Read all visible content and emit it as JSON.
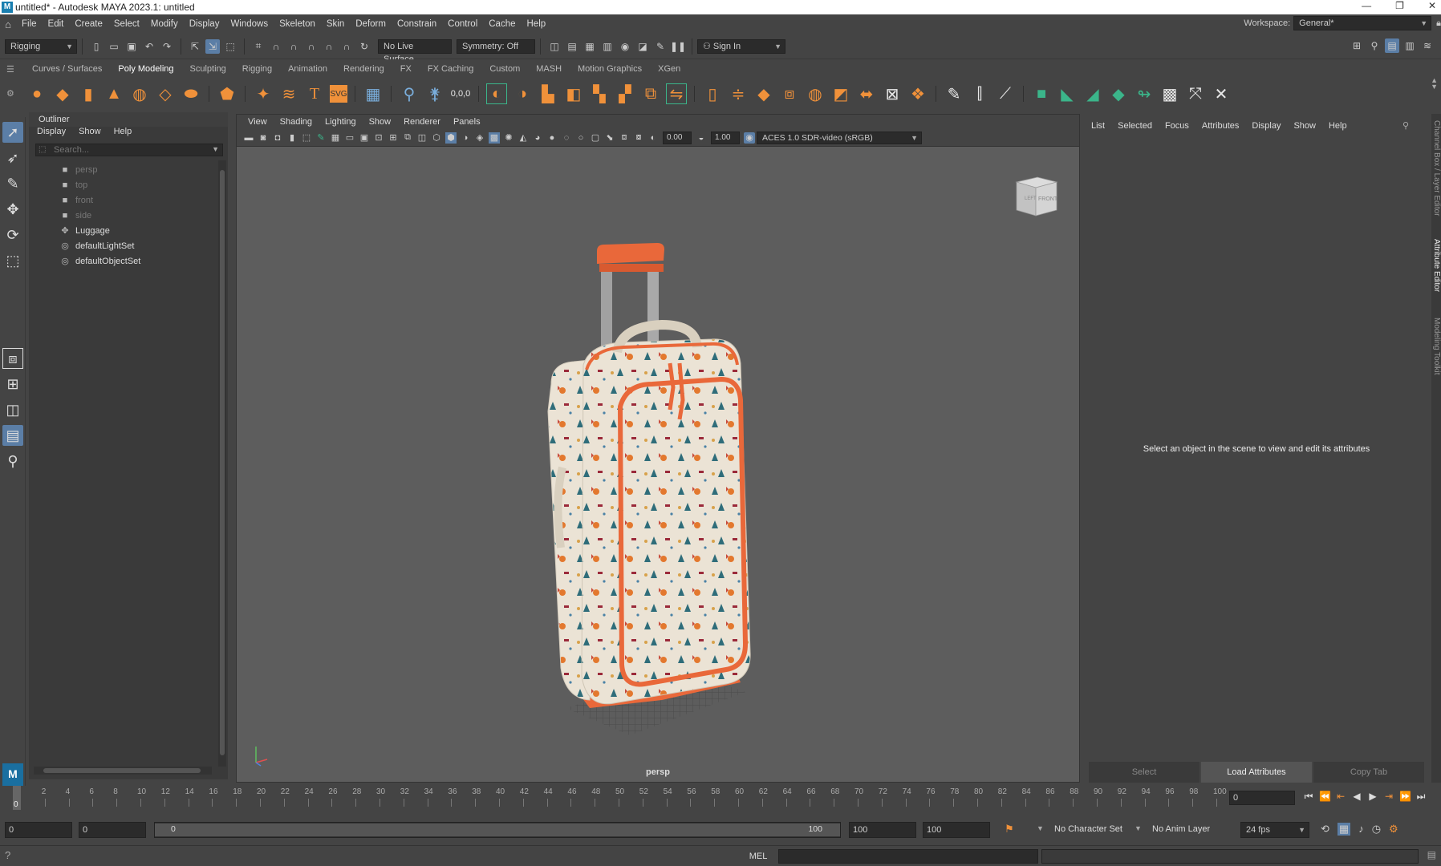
{
  "window": {
    "title": "untitled* - Autodesk MAYA 2023.1: untitled",
    "controls": [
      "—",
      "❐",
      "✕"
    ]
  },
  "menubar": {
    "items": [
      "File",
      "Edit",
      "Create",
      "Select",
      "Modify",
      "Display",
      "Windows",
      "Skeleton",
      "Skin",
      "Deform",
      "Constrain",
      "Control",
      "Cache",
      "Help"
    ],
    "workspace_label": "Workspace:",
    "workspace_value": "General*"
  },
  "statusline": {
    "menuset": "Rigging",
    "live_surface": "No Live Surface",
    "symmetry": "Symmetry: Off",
    "sign_in": "Sign In"
  },
  "shelf": {
    "tabs": [
      "Curves / Surfaces",
      "Poly Modeling",
      "Sculpting",
      "Rigging",
      "Animation",
      "Rendering",
      "FX",
      "FX Caching",
      "Custom",
      "MASH",
      "Motion Graphics",
      "XGen"
    ],
    "active_tab": "Poly Modeling"
  },
  "outliner": {
    "title": "Outliner",
    "menus": [
      "Display",
      "Show",
      "Help"
    ],
    "search_placeholder": "Search...",
    "items": [
      {
        "label": "persp",
        "dim": true
      },
      {
        "label": "top",
        "dim": true
      },
      {
        "label": "front",
        "dim": true
      },
      {
        "label": "side",
        "dim": true
      },
      {
        "label": "Luggage",
        "dim": false
      },
      {
        "label": "defaultLightSet",
        "dim": false
      },
      {
        "label": "defaultObjectSet",
        "dim": false
      }
    ]
  },
  "viewport": {
    "menus": [
      "View",
      "Shading",
      "Lighting",
      "Show",
      "Renderer",
      "Panels"
    ],
    "exposure": "0.00",
    "gamma": "1.00",
    "color_space": "ACES 1.0 SDR-video (sRGB)",
    "camera_label": "persp",
    "viewcube_left": "LEFT",
    "viewcube_front": "FRONT"
  },
  "attribute_editor": {
    "menus": [
      "List",
      "Selected",
      "Focus",
      "Attributes",
      "Display",
      "Show",
      "Help"
    ],
    "message": "Select an object in the scene to view and edit its attributes",
    "buttons": [
      "Select",
      "Load Attributes",
      "Copy Tab"
    ],
    "side_tabs": [
      "Channel Box / Layer Editor",
      "Attribute Editor",
      "Modeling Toolkit"
    ]
  },
  "timeline": {
    "ticks": [
      "2",
      "4",
      "6",
      "8",
      "10",
      "12",
      "14",
      "16",
      "18",
      "20",
      "22",
      "24",
      "26",
      "28",
      "30",
      "32",
      "34",
      "36",
      "38",
      "40",
      "42",
      "44",
      "46",
      "48",
      "50",
      "52",
      "54",
      "56",
      "58",
      "60",
      "62",
      "64",
      "66",
      "68",
      "70",
      "72",
      "74",
      "76",
      "78",
      "80",
      "82",
      "84",
      "86",
      "88",
      "90",
      "92",
      "94",
      "96",
      "98",
      "100"
    ],
    "current_frame": "0",
    "cursor_frame": "0"
  },
  "range": {
    "start": "0",
    "playback_start": "0",
    "slider_start": "0",
    "slider_end": "100",
    "playback_end": "100",
    "end": "100",
    "character_set": "No Character Set",
    "anim_layer": "No Anim Layer",
    "fps": "24 fps"
  },
  "cmdline": {
    "language": "MEL"
  },
  "colors": {
    "accent": "#5b7ea6",
    "shelf_orange": "#f0913a",
    "shelf_green": "#3bb58a",
    "luggage_orange": "#e9683a"
  }
}
